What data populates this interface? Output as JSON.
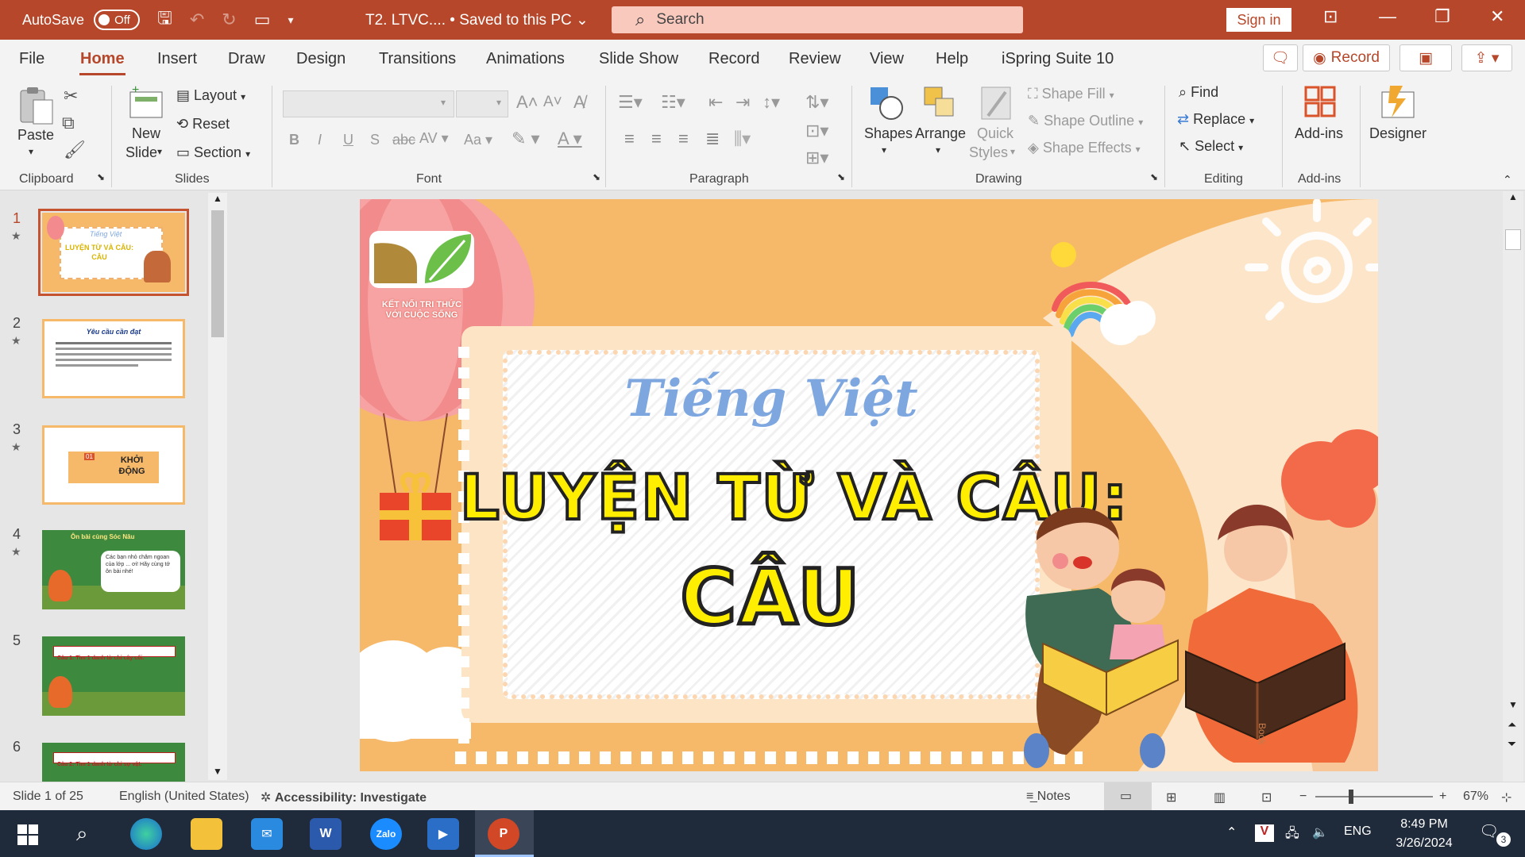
{
  "titlebar": {
    "autosave_label": "AutoSave",
    "autosave_state": "Off",
    "doc_title": "T2. LTVC.... • Saved to this PC ⌄",
    "search_placeholder": "Search",
    "signin_label": "Sign in"
  },
  "menu": {
    "tabs": [
      "File",
      "Home",
      "Insert",
      "Draw",
      "Design",
      "Transitions",
      "Animations",
      "Slide Show",
      "Record",
      "Review",
      "View",
      "Help",
      "iSpring Suite 10"
    ],
    "active": "Home",
    "record_label": "Record"
  },
  "ribbon": {
    "clipboard": {
      "paste": "Paste",
      "group": "Clipboard"
    },
    "slides": {
      "new_slide_1": "New",
      "new_slide_2": "Slide",
      "layout": "Layout",
      "reset": "Reset",
      "section": "Section",
      "group": "Slides"
    },
    "font": {
      "group": "Font",
      "bold": "B",
      "italic": "I",
      "underline": "U",
      "strike": "S",
      "aa": "Aa"
    },
    "paragraph": {
      "group": "Paragraph"
    },
    "drawing": {
      "shapes": "Shapes",
      "arrange": "Arrange",
      "quick_1": "Quick",
      "quick_2": "Styles",
      "shape_fill": "Shape Fill",
      "shape_outline": "Shape Outline",
      "shape_effects": "Shape Effects",
      "group": "Drawing"
    },
    "editing": {
      "find": "Find",
      "replace": "Replace",
      "select": "Select",
      "group": "Editing"
    },
    "addins": {
      "label": "Add-ins",
      "group": "Add-ins"
    },
    "designer": {
      "label": "Designer"
    }
  },
  "thumbnails": [
    {
      "num": "1",
      "title_small": "Tiếng Việt",
      "title_big": "LUYỆN TỪ VÀ CÂU: CÂU"
    },
    {
      "num": "2",
      "title": "Yêu cầu cần đạt"
    },
    {
      "num": "3",
      "tag": "01",
      "title": "KHỞI ĐỘNG"
    },
    {
      "num": "4",
      "title": "Ôn bài cùng Sóc Nâu",
      "bubble": "Các bạn nhỏ chăm ngoan của lớp ... ơi! Hãy cùng tớ ôn bài nhé!"
    },
    {
      "num": "5",
      "title": "Câu 1: Tìm 1 danh từ chỉ cây cối."
    },
    {
      "num": "6",
      "title": "Câu 2: Tìm 1 danh từ chỉ sự vật."
    }
  ],
  "slide": {
    "logo_line1": "KẾT NỐI TRI THỨC",
    "logo_line2": "VỚI CUỘC SỐNG",
    "subtitle": "Tiếng Việt",
    "title_line1": "LUYỆN TỪ VÀ CÂU:",
    "title_line2": "CÂU",
    "book_text": "Book"
  },
  "status": {
    "slide_info": "Slide 1 of 25",
    "language": "English (United States)",
    "accessibility": "Accessibility: Investigate",
    "notes": "Notes",
    "zoom": "67%"
  },
  "taskbar": {
    "lang": "ENG",
    "time": "8:49 PM",
    "date": "3/26/2024",
    "notif_count": "3",
    "zalo": "Zalo",
    "word": "W",
    "ppt": "P"
  },
  "colors": {
    "accent": "#b7472a",
    "slide_bg": "#f6b869",
    "title_yellow": "#ffee00",
    "subtitle_blue": "#7ea7e0"
  }
}
